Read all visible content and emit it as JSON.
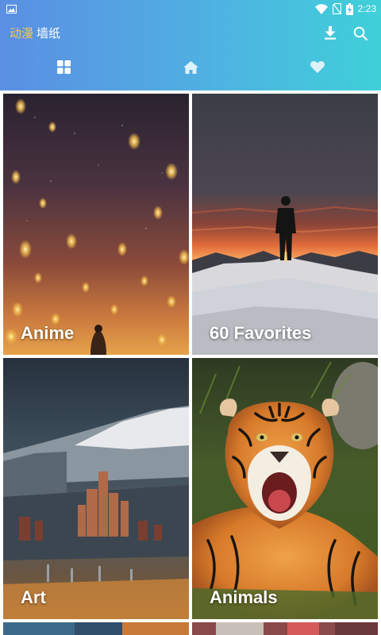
{
  "status_bar": {
    "time": "2:23",
    "icons": [
      "image-notification-icon",
      "wifi-icon",
      "no-sim-icon",
      "battery-charging-icon"
    ]
  },
  "toolbar": {
    "title_part1": "动漫",
    "title_part2": "墙纸",
    "actions": [
      "download-icon",
      "search-icon"
    ]
  },
  "tabs": [
    {
      "icon": "grid-icon",
      "label": "categories",
      "active": true
    },
    {
      "icon": "home-icon",
      "label": "home",
      "active": false
    },
    {
      "icon": "heart-icon",
      "label": "favorites",
      "active": false
    }
  ],
  "categories": [
    {
      "label": "Anime"
    },
    {
      "label": "60 Favorites"
    },
    {
      "label": "Art"
    },
    {
      "label": "Animals"
    },
    {
      "label": ""
    },
    {
      "label": ""
    }
  ],
  "colors": {
    "app_bar_start": "#5b8fe3",
    "app_bar_end": "#3fd0d9",
    "title_accent": "#f6c94b",
    "icon_active": "#ffffff",
    "icon_inactive": "#dff2fb"
  }
}
